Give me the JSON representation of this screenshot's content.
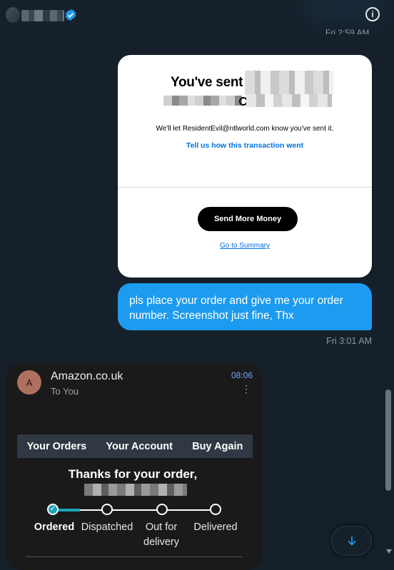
{
  "payment_card": {
    "title": "You've sent",
    "message": "We'll let ResidentEvil@ntlworld.com know you've sent it.",
    "feedback_link": "Tell us how this transaction went",
    "send_more_button": "Send More Money",
    "summary_link": "Go to Summary"
  },
  "outgoing_message": {
    "text": "pls place your order and give me your order number. Screenshot just fine, Thx",
    "timestamp": "Fri 3:01 AM"
  },
  "email": {
    "avatar_initial": "A",
    "sender": "Amazon.co.uk",
    "recipient": "To You",
    "time": "08:06",
    "nav": [
      "Your Orders",
      "Your Account",
      "Buy Again"
    ],
    "heading": "Thanks for your order,",
    "progress": {
      "steps": [
        "Ordered",
        "Dispatched",
        "Out for delivery",
        "Delivered"
      ],
      "completed_steps": 1
    }
  },
  "icons": {
    "verified": "verified-badge-icon",
    "info": "info-icon",
    "more": "more-vertical-icon",
    "scroll_down": "arrow-down-icon"
  },
  "colors": {
    "background": "#15202b",
    "bubble": "#1d9bf0",
    "link": "#0070e0",
    "progress": "#1aa3b5"
  }
}
